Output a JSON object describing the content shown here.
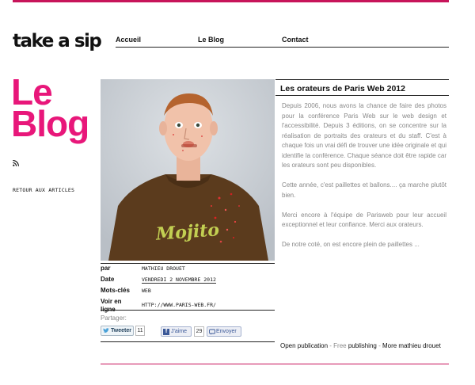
{
  "brand": {
    "logo": "take a sip",
    "accent_color": "#e8177a"
  },
  "nav": {
    "items": [
      "Accueil",
      "Le Blog",
      "Contact"
    ]
  },
  "sidebar": {
    "title_line1": "Le",
    "title_line2": "Blog",
    "rss_icon": "rss-icon",
    "back_link": "RETOUR AUX ARTICLES"
  },
  "post": {
    "image_alt": "Portrait d'un homme en t-shirt marron Mojito",
    "meta": [
      {
        "key": "par",
        "value": "MATHIEU DROUET"
      },
      {
        "key": "Date",
        "value": "VENDREDI 2 NOVEMBRE 2012"
      },
      {
        "key": "Mots-clés",
        "value": "WEB"
      },
      {
        "key": "Voir en ligne",
        "value": "HTTP://WWW.PARIS-WEB.FR/"
      }
    ],
    "share": {
      "label": "Partager:",
      "tweet_label": "Tweeter",
      "tweet_count": "11",
      "like_label": "J'aime",
      "like_count": "29",
      "send_label": "Envoyer"
    }
  },
  "article": {
    "title": "Les orateurs de Paris Web 2012",
    "paragraphs": [
      "Depuis 2006, nous avons la chance de faire des photos pour la conférence Paris Web sur le web design et l'accessibilité. Depuis 3 éditions, on se concentre sur la réalisation de portraits des orateurs et du staff. C'est à chaque fois un vrai défi de trouver une idée originale et qui identifie la conférence. Chaque séance doit être rapide car les orateurs sont peu disponibles.",
      "Cette année, c'est paillettes et ballons.... ça marche plutôt bien.",
      "Merci encore à l'équipe de Parisweb pour leur accueil exceptionnel et leur confiance. Merci aux orateurs.",
      "De notre coté, on est encore plein de paillettes ..."
    ]
  },
  "publication": {
    "open_publication": "Open publication",
    "sep1": " - ",
    "free": "Free",
    "publishing": " publishing",
    "sep2": " - ",
    "more": "More mathieu drouet"
  }
}
